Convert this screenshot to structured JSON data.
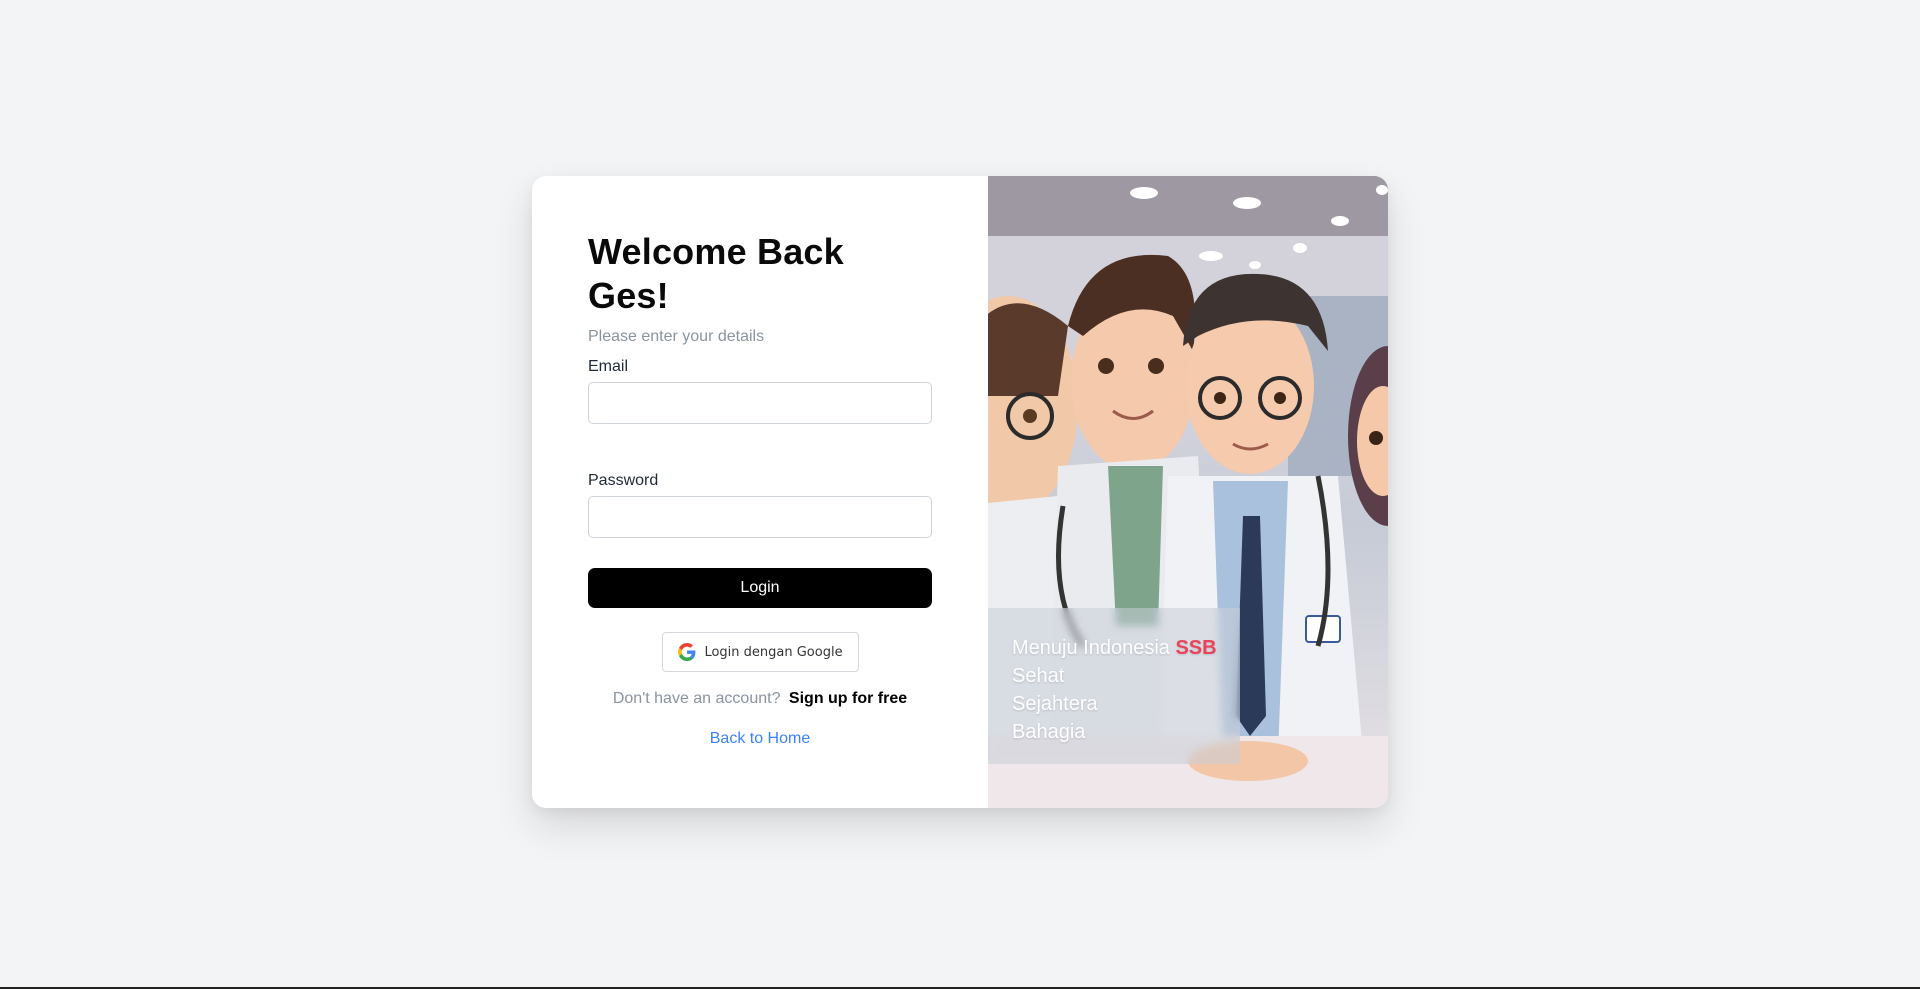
{
  "login": {
    "title": "Welcome Back Ges!",
    "subtitle": "Please enter your details",
    "email_label": "Email",
    "email_value": "",
    "password_label": "Password",
    "password_value": "",
    "login_button": "Login",
    "google_button": "Login dengan Google",
    "signup_question": "Don't have an account?",
    "signup_link": "Sign up for free",
    "back_home": "Back to Home"
  },
  "hero": {
    "tagline_prefix": "Menuju Indonesia",
    "tagline_accent": "SSB",
    "lines": [
      "Sehat",
      "Sejahtera",
      "Bahagia"
    ],
    "accent_color": "#e8445a"
  },
  "icons": {
    "google": "google-g-icon"
  }
}
